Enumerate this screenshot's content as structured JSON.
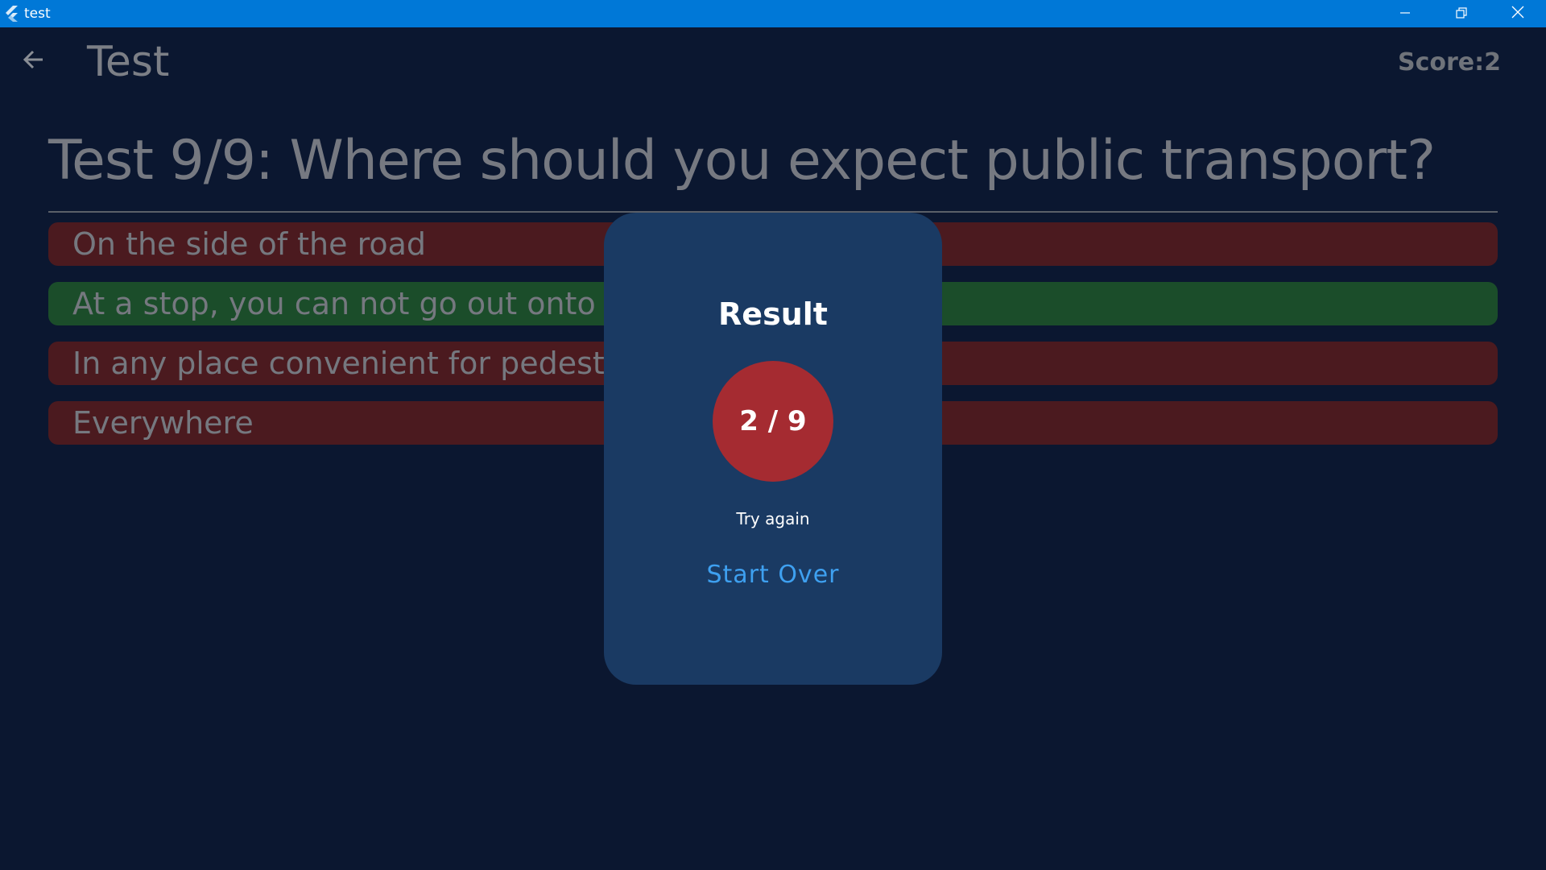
{
  "window": {
    "title": "test",
    "controls": [
      "minimize",
      "restore",
      "close"
    ]
  },
  "appbar": {
    "title": "Test",
    "score": "Score:2"
  },
  "question": {
    "text": "Test 9/9: Where should you expect public transport?"
  },
  "answers": [
    {
      "label": "On the side of the road",
      "state": "wrong"
    },
    {
      "label": "At a stop, you can not go out onto the",
      "state": "correct"
    },
    {
      "label": "In any place convenient for pedestrian",
      "state": "wrong"
    },
    {
      "label": "Everywhere",
      "state": "wrong"
    }
  ],
  "dialog": {
    "title": "Result",
    "score": "2 / 9",
    "message": "Try again",
    "action": "Start Over"
  },
  "colors": {
    "titlebar": "#0078d7",
    "background": "#0b1730",
    "wrong": "#4b1a1f",
    "correct": "#1b4d2a",
    "dialog": "#1a3a63",
    "result_circle": "#a52b31",
    "link": "#3ea0f0"
  },
  "icons": {
    "app": "flutter-icon",
    "back": "arrow-left-icon",
    "minimize": "minimize-icon",
    "restore": "restore-icon",
    "close": "close-icon"
  }
}
